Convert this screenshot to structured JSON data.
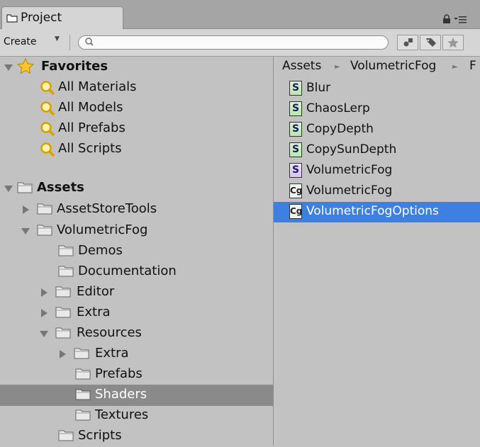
{
  "window": {
    "tab_title": "Project",
    "tab_icon": "folder-icon"
  },
  "toolbar": {
    "create_label": "Create",
    "search": {
      "placeholder": "",
      "value": ""
    },
    "buttons": [
      "filter-by-type-icon",
      "filter-by-label-icon",
      "favorite-star-icon"
    ]
  },
  "left_pane": {
    "favorites": {
      "label": "Favorites",
      "items": [
        "All Materials",
        "All Models",
        "All Prefabs",
        "All Scripts"
      ]
    },
    "assets": {
      "label": "Assets",
      "tree": [
        {
          "label": "AssetStoreTools",
          "state": "collapsed"
        },
        {
          "label": "VolumetricFog",
          "state": "expanded"
        },
        {
          "label": "Demos",
          "state": "leaf"
        },
        {
          "label": "Documentation",
          "state": "leaf"
        },
        {
          "label": "Editor",
          "state": "collapsed"
        },
        {
          "label": "Extra",
          "state": "collapsed"
        },
        {
          "label": "Resources",
          "state": "expanded"
        },
        {
          "label": "Extra",
          "state": "collapsed"
        },
        {
          "label": "Prefabs",
          "state": "leaf"
        },
        {
          "label": "Shaders",
          "state": "selected"
        },
        {
          "label": "Textures",
          "state": "leaf"
        },
        {
          "label": "Scripts",
          "state": "leaf"
        }
      ]
    }
  },
  "right_pane": {
    "breadcrumb": [
      "Assets",
      "VolumetricFog",
      "F"
    ],
    "files": [
      {
        "name": "Blur",
        "badge": "S",
        "kind": "shader"
      },
      {
        "name": "ChaosLerp",
        "badge": "S",
        "kind": "shader"
      },
      {
        "name": "CopyDepth",
        "badge": "S",
        "kind": "shader"
      },
      {
        "name": "CopySunDepth",
        "badge": "S",
        "kind": "shader"
      },
      {
        "name": "VolumetricFog",
        "badge": "S",
        "kind": "shader-alt"
      },
      {
        "name": "VolumetricFog",
        "badge": "Cg",
        "kind": "cginc"
      },
      {
        "name": "VolumetricFogOptions",
        "badge": "Cg",
        "kind": "cginc",
        "selected": true
      }
    ]
  },
  "colors": {
    "selection_blue": "#3d80df",
    "tree_selection": "#8a8a8a",
    "pane_bg": "#c2c2c2"
  }
}
